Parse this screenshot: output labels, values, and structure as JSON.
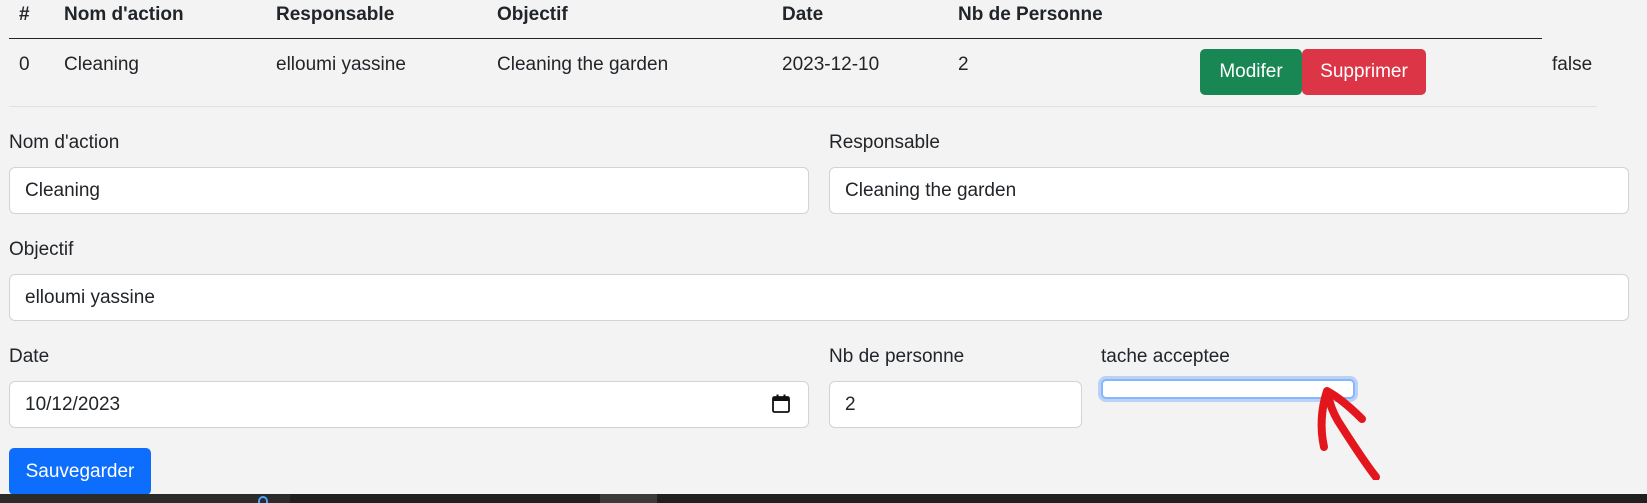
{
  "table": {
    "headers": [
      "#",
      "Nom d'action",
      "Responsable",
      "Objectif",
      "Date",
      "Nb de Personne"
    ],
    "rows": [
      {
        "index": "0",
        "nom_action": "Cleaning",
        "responsable": "elloumi yassine",
        "objectif": "Cleaning the garden",
        "date": "2023-12-10",
        "nb_personne": "2",
        "modify_label": "Modifer",
        "delete_label": "Supprimer",
        "accepted": "false"
      }
    ]
  },
  "form": {
    "nom_action": {
      "label": "Nom d'action",
      "value": "Cleaning"
    },
    "responsable": {
      "label": "Responsable",
      "value": "Cleaning the garden"
    },
    "objectif": {
      "label": "Objectif",
      "value": "elloumi yassine"
    },
    "date": {
      "label": "Date",
      "value": "10/12/2023"
    },
    "nb_personne": {
      "label": "Nb de personne",
      "value": "2"
    },
    "tache_acceptee": {
      "label": "tache acceptee",
      "value": ""
    },
    "save_label": "Sauvegarder"
  },
  "colors": {
    "background": "#f3f3f3",
    "success": "#198754",
    "danger": "#dc3545",
    "primary": "#0d6efd",
    "annotation_arrow": "#e3161e"
  },
  "icons": {
    "calendar": "calendar-icon",
    "annotation": "red-arrow-annotation"
  }
}
